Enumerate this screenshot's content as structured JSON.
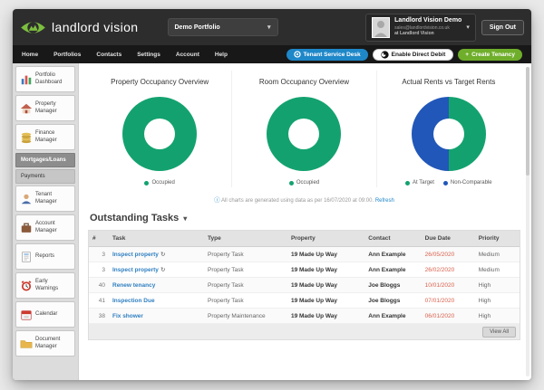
{
  "header": {
    "logo_text": "landlord vision",
    "portfolio_selector": "Demo Portfolio",
    "user": {
      "name": "Landlord Vision Demo",
      "email": "sales@landlordvision.co.uk",
      "org": "at Landlord Vision"
    },
    "sign_out_label": "Sign Out"
  },
  "nav": {
    "items": [
      "Home",
      "Portfolios",
      "Contacts",
      "Settings",
      "Account",
      "Help"
    ]
  },
  "toolbar": {
    "tenant_service_desk_label": "Tenant Service Desk",
    "enable_direct_debit_label": "Enable Direct Debit",
    "create_tenancy_label": "Create Tenancy"
  },
  "sidebar": {
    "items": [
      {
        "label": "Portfolio Dashboard",
        "icon": "bar-chart-icon"
      },
      {
        "label": "Property Manager",
        "icon": "house-icon"
      },
      {
        "label": "Finance Manager",
        "icon": "coins-icon"
      },
      {
        "label": "Mortgages/Loans",
        "icon": null
      },
      {
        "label": "Payments",
        "icon": null
      },
      {
        "label": "Tenant Manager",
        "icon": "person-icon"
      },
      {
        "label": "Account Manager",
        "icon": "briefcase-icon"
      },
      {
        "label": "Reports",
        "icon": "report-icon"
      },
      {
        "label": "Early Warnings",
        "icon": "alarm-icon"
      },
      {
        "label": "Calendar",
        "icon": "calendar-icon"
      },
      {
        "label": "Document Manager",
        "icon": "folder-icon"
      }
    ]
  },
  "chart_data": [
    {
      "type": "pie",
      "donut": true,
      "legend_position": "bottom",
      "title": "Property Occupancy Overview",
      "labels": [
        "Occupied"
      ],
      "values": [
        100
      ],
      "colors": [
        "#13a26f"
      ]
    },
    {
      "type": "pie",
      "donut": true,
      "legend_position": "bottom",
      "title": "Room Occupancy Overview",
      "labels": [
        "Occupied"
      ],
      "values": [
        100
      ],
      "colors": [
        "#13a26f"
      ]
    },
    {
      "type": "pie",
      "donut": true,
      "legend_position": "bottom",
      "title": "Actual Rents vs Target Rents",
      "labels": [
        "At Target",
        "Non-Comparable"
      ],
      "values": [
        50,
        50
      ],
      "colors": [
        "#13a26f",
        "#2157b8"
      ]
    }
  ],
  "charts_note": {
    "info_icon": "ⓘ",
    "text": "All charts are generated using data as per 16/07/2020 at 09:00.",
    "refresh_label": "Refresh"
  },
  "tasks": {
    "title": "Outstanding Tasks",
    "columns": [
      "#",
      "Task",
      "Type",
      "Property",
      "Contact",
      "Due Date",
      "Priority"
    ],
    "rows": [
      {
        "num": "3",
        "task": "Inspect property",
        "recurring": true,
        "type": "Property Task",
        "property": "19 Made Up Way",
        "contact": "Ann Example",
        "due": "26/05/2020",
        "priority": "Medium"
      },
      {
        "num": "3",
        "task": "Inspect property",
        "recurring": true,
        "type": "Property Task",
        "property": "19 Made Up Way",
        "contact": "Ann Example",
        "due": "26/02/2020",
        "priority": "Medium"
      },
      {
        "num": "40",
        "task": "Renew tenancy",
        "recurring": false,
        "type": "Property Task",
        "property": "19 Made Up Way",
        "contact": "Joe Bloggs",
        "due": "10/01/2020",
        "priority": "High"
      },
      {
        "num": "41",
        "task": "Inspection Due",
        "recurring": false,
        "type": "Property Task",
        "property": "19 Made Up Way",
        "contact": "Joe Bloggs",
        "due": "07/01/2020",
        "priority": "High"
      },
      {
        "num": "38",
        "task": "Fix shower",
        "recurring": false,
        "type": "Property Maintenance",
        "property": "19 Made Up Way",
        "contact": "Ann Example",
        "due": "06/01/2020",
        "priority": "High"
      }
    ],
    "view_all_label": "View All"
  },
  "icons": {
    "caret_down": "▾",
    "recurring": "↻",
    "plus": "+"
  },
  "colors": {
    "brand_green": "#7cbf3f",
    "chart_green": "#13a26f",
    "chart_blue": "#2157b8",
    "button_blue": "#1e87c8",
    "button_green": "#6fae2b",
    "due_date_red": "#d9604c"
  }
}
